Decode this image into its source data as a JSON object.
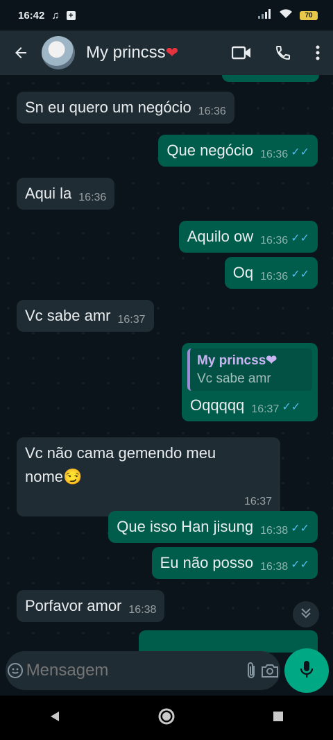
{
  "status": {
    "time": "16:42",
    "battery": "70"
  },
  "header": {
    "contact_name": "My princss",
    "heart": "❤"
  },
  "messages": [
    {
      "text": "Sn eu quero um negócio",
      "time": "16:36"
    },
    {
      "text": "Que negócio",
      "time": "16:36"
    },
    {
      "text": "Aqui la",
      "time": "16:36"
    },
    {
      "text": "Aquilo ow",
      "time": "16:36"
    },
    {
      "text": "Oq",
      "time": "16:36"
    },
    {
      "text": "Vc sabe amr",
      "time": "16:37"
    },
    {
      "text": "Oqqqqq",
      "time": "16:37",
      "quote_name": "My princss❤",
      "quote_text": "Vc sabe amr"
    },
    {
      "text": "Vc não cama gemendo meu nome😏",
      "time": "16:37"
    },
    {
      "text": "Que isso Han jisung",
      "time": "16:38"
    },
    {
      "text": "Eu não posso",
      "time": "16:38"
    },
    {
      "text": "Porfavor amor",
      "time": "16:38"
    }
  ],
  "composer": {
    "placeholder": "Mensagem"
  },
  "colors": {
    "incoming": "#1f2c33",
    "outgoing": "#005c4b",
    "accent": "#00a884",
    "read_ticks": "#53bdeb"
  }
}
